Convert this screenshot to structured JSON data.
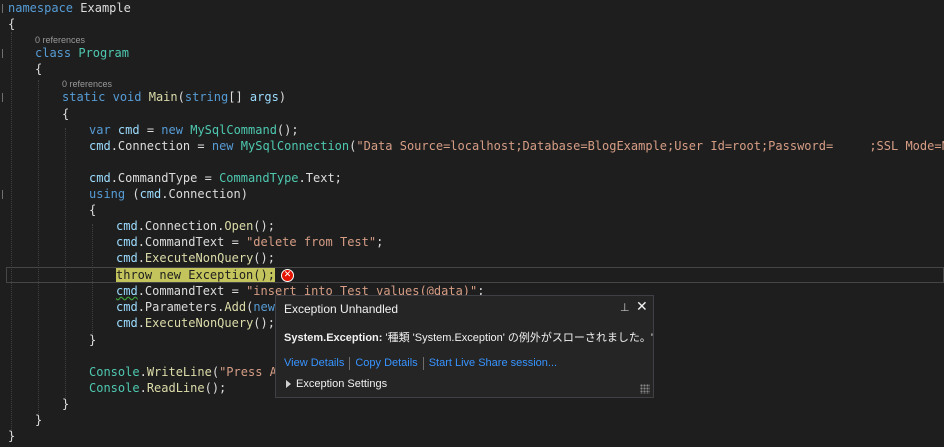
{
  "editor": {
    "code_lens": {
      "class": "0 references",
      "method": "0 references"
    },
    "lines": {
      "l1": {
        "kw": "namespace",
        "name": "Example"
      },
      "l2": {
        "p": "{"
      },
      "l3": {
        "kw": "class",
        "name": "Program"
      },
      "l4": {
        "p": "{"
      },
      "l5": {
        "kw1": "static",
        "kw2": "void",
        "name": "Main",
        "p1": "(",
        "kw3": "string",
        "p2": "[] ",
        "param": "args",
        "p3": ")"
      },
      "l6": {
        "p": "{"
      },
      "l7": {
        "kw1": "var",
        "var": "cmd",
        "p1": " = ",
        "kw2": "new",
        "type": "MySqlCommand",
        "p2": "();"
      },
      "l8": {
        "var": "cmd",
        "p1": ".Connection = ",
        "kw": "new",
        "type": "MySqlConnection",
        "p2": "(",
        "str": "\"Data Source=localhost;Database=BlogExample;User Id=root;Password=",
        "str2": ";SSL Mode=None\"",
        "p3": ");"
      },
      "l9": {
        "var": "cmd",
        "p1": ".CommandType = ",
        "type": "CommandType",
        "p2": ".Text;"
      },
      "l10": {
        "kw": "using",
        "p1": " (",
        "var": "cmd",
        "p2": ".Connection)"
      },
      "l11": {
        "p": "{"
      },
      "l12": {
        "var": "cmd",
        "p1": ".Connection.",
        "method": "Open",
        "p2": "();"
      },
      "l13": {
        "var": "cmd",
        "p1": ".CommandText = ",
        "str": "\"delete from Test\"",
        "p2": ";"
      },
      "l14": {
        "var": "cmd",
        "p1": ".",
        "method": "ExecuteNonQuery",
        "p2": "();"
      },
      "l15": {
        "code": "throw new Exception();"
      },
      "l16": {
        "var": "cmd",
        "p1": ".CommandText = ",
        "str": "\"insert into Test values(@data)\"",
        "p2": ";"
      },
      "l17": {
        "var": "cmd",
        "p1": ".Parameters.",
        "method": "Add",
        "p2": "(",
        "kw": "new"
      },
      "l18": {
        "var": "cmd",
        "p1": ".",
        "method": "ExecuteNonQuery",
        "p2": "();"
      },
      "l19": {
        "p": "}"
      },
      "l20": {
        "type": "Console",
        "p1": ".",
        "method": "WriteLine",
        "p2": "(",
        "str": "\"Press An"
      },
      "l21": {
        "type": "Console",
        "p1": ".",
        "method": "ReadLine",
        "p2": "();"
      },
      "l22": {
        "p": "}"
      },
      "l23": {
        "p": "}"
      },
      "l24": {
        "p": "}"
      }
    }
  },
  "exception_popup": {
    "title": "Exception Unhandled",
    "pin_icon": "pin-icon",
    "close_icon": "close-icon",
    "exception_type": "System.Exception:",
    "message": " '種類 'System.Exception' の例外がスローされました。'",
    "links": [
      "View Details",
      "Copy Details",
      "Start Live Share session..."
    ],
    "settings_label": "Exception Settings"
  },
  "colors": {
    "background": "#1e1e1e",
    "keyword": "#569cd6",
    "type": "#4ec9b0",
    "string": "#d69d85",
    "method": "#dcdcaa",
    "variable": "#9cdcfe",
    "error": "#e51400",
    "link": "#3794ff",
    "highlight": "#c4c45d"
  }
}
